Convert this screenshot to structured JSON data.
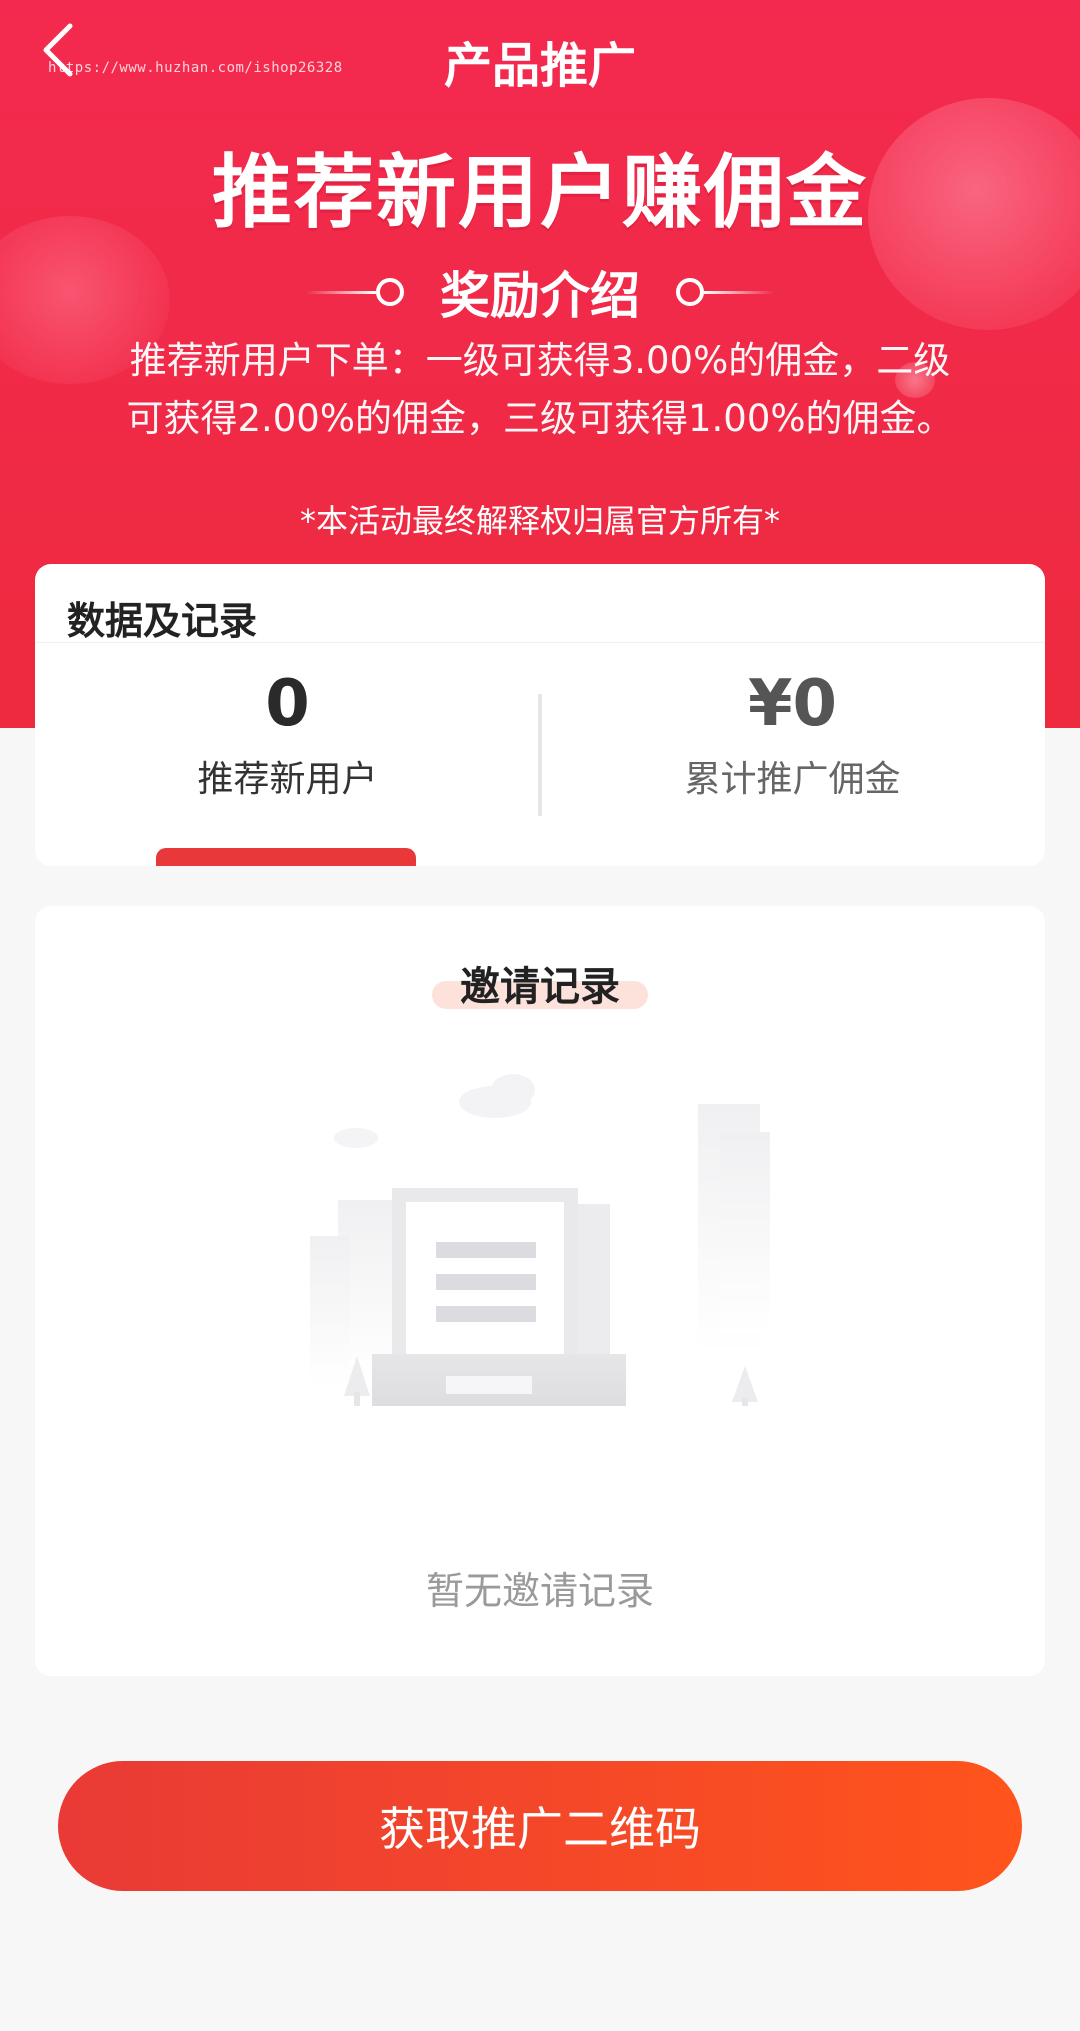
{
  "nav": {
    "title": "产品推广",
    "back_icon": "chevron-left-icon",
    "watermark": "https://www.huzhan.com/ishop26328"
  },
  "hero": {
    "headline": "推荐新用户赚佣金",
    "section_label": "奖励介绍",
    "reward_line1": "推荐新用户下单：一级可获得3.00%的佣金，二级",
    "reward_line2": "可获得2.00%的佣金，三级可获得1.00%的佣金。",
    "disclaimer": "*本活动最终解释权归属官方所有*"
  },
  "data_card": {
    "title": "数据及记录",
    "new_users_value": "0",
    "new_users_label": "推荐新用户",
    "commission_value": "¥0",
    "commission_label": "累计推广佣金"
  },
  "invite_card": {
    "title": "邀请记录",
    "empty_text": "暂无邀请记录"
  },
  "action": {
    "qr_button_label": "获取推广二维码"
  },
  "colors": {
    "hero_red": "#f02a48",
    "button_start": "#e93a36",
    "button_end": "#ff541c",
    "tab_indicator": "#e8383a",
    "title_highlight": "#fde2dc"
  }
}
